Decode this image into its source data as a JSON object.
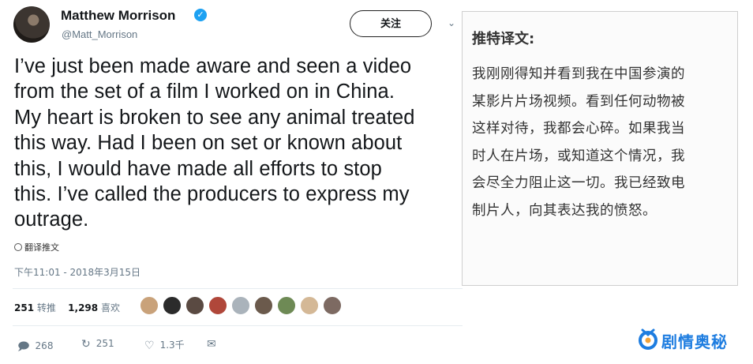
{
  "tweet": {
    "author_name": "Matthew Morrison",
    "handle": "@Matt_Morrison",
    "follow_label": "关注",
    "text_lines": [
      "I’ve just been made aware and seen a video",
      "from the set of a film I worked on in China.",
      "My heart is broken to see any animal treated",
      "this way.  Had I been on set or known about",
      "this, I would have made all efforts to stop",
      "this.  I’ve called the producers to express my",
      "outrage."
    ],
    "translate_label": "翻译推文",
    "timestamp": "下午11:01 - 2018年3月15日",
    "retweets_count": "251",
    "retweets_label": "转推",
    "likes_count": "1,298",
    "likes_label": "喜欢",
    "actions": {
      "reply_count": "268",
      "retweet_count": "251",
      "like_count": "1.3千"
    },
    "icons": [
      "verified-badge-icon",
      "chevron-down-icon",
      "globe-icon",
      "reply-icon",
      "retweet-icon",
      "heart-icon",
      "message-icon"
    ]
  },
  "translation": {
    "title": "推特译文:",
    "lines": [
      "我刚刚得知并看到我在中国参演的",
      "某影片片场视频。看到任何动物被",
      "这样对待，我都会心碎。如果我当",
      "时人在片场，或知道这个情况，我",
      "会尽全力阻止这一切。我已经致电",
      "制片人，向其表达我的愤怒。"
    ]
  },
  "watermark": {
    "text": "剧情奥秘"
  },
  "colors": {
    "verified_blue": "#1da1f2",
    "watermark_blue": "#1e7de0",
    "secondary_text": "#657786"
  }
}
